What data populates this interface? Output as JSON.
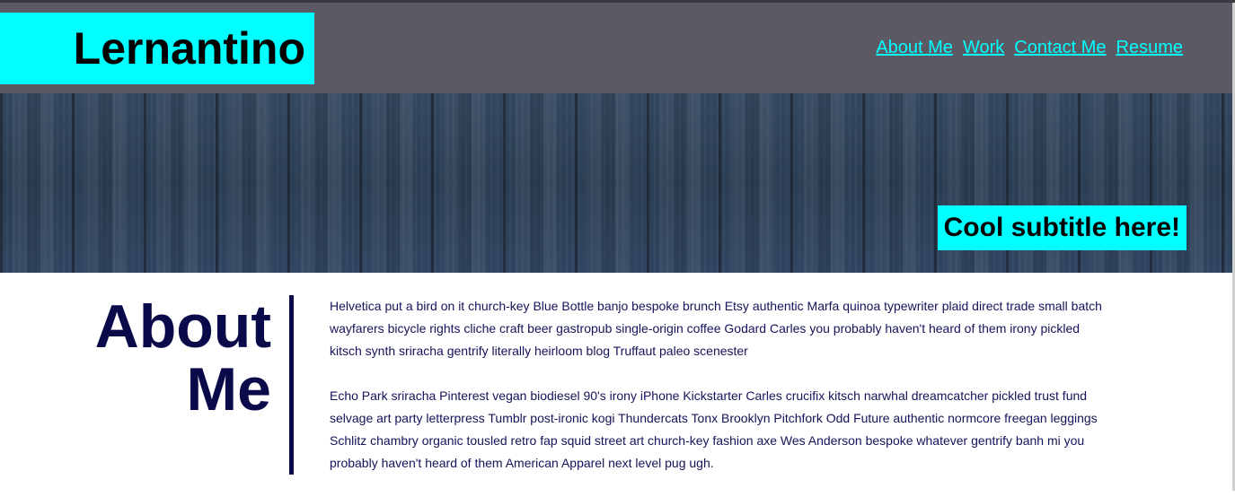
{
  "header": {
    "logo": "Lernantino",
    "nav": [
      "About Me",
      "Work",
      "Contact Me",
      "Resume"
    ]
  },
  "hero": {
    "subtitle": "Cool subtitle here!"
  },
  "about": {
    "heading_line1": "About",
    "heading_line2": "Me",
    "paragraphs": [
      "Helvetica put a bird on it church-key Blue Bottle banjo bespoke brunch Etsy authentic Marfa quinoa typewriter plaid direct trade small batch wayfarers bicycle rights cliche craft beer gastropub single-origin coffee Godard Carles you probably haven't heard of them irony pickled kitsch synth sriracha gentrify literally heirloom blog Truffaut paleo scenester",
      "Echo Park sriracha Pinterest vegan biodiesel 90's irony iPhone Kickstarter Carles crucifix kitsch narwhal dreamcatcher pickled trust fund selvage art party letterpress Tumblr post-ironic kogi Thundercats Tonx Brooklyn Pitchfork Odd Future authentic normcore freegan leggings Schlitz chambry organic tousled retro fap squid street art church-key fashion axe Wes Anderson bespoke whatever gentrify banh mi you probably haven't heard of them American Apparel next level pug ugh."
    ]
  },
  "colors": {
    "accent": "#00ffff",
    "header_bg": "#5b5964",
    "heading_text": "#0a0a4a"
  }
}
